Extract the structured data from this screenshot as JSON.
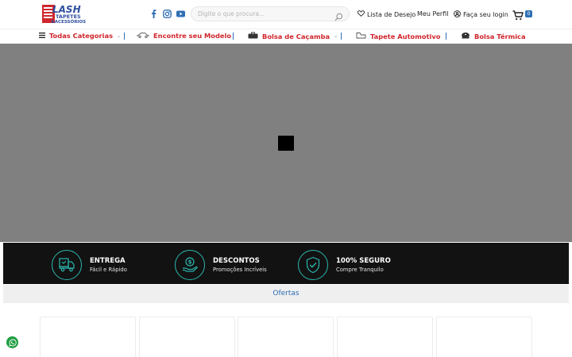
{
  "brand": {
    "logo_text_1": "FLASH",
    "logo_text_2": "TAPETES",
    "logo_text_3": "& ACESSÓRIOS",
    "primary_color": "#d0262c",
    "accent_color": "#2f6fb5"
  },
  "header": {
    "social": [
      "facebook-icon",
      "instagram-icon",
      "youtube-icon"
    ],
    "search_placeholder": "Digite o que procura...",
    "wishlist_label": "Lista de Desejo",
    "profile_label": "Meu Perfil",
    "login_label": "Faça seu login",
    "cart_count": "0"
  },
  "nav": {
    "items": [
      {
        "label": "Todas Categorias",
        "icon": "menu-icon"
      },
      {
        "label": "Encontre seu Modelo",
        "icon": "car-icon"
      },
      {
        "label": "Bolsa de Caçamba",
        "icon": "bag-icon"
      },
      {
        "label": "Tapete Automotivo",
        "icon": "mat-icon"
      },
      {
        "label": "Bolsa Térmica",
        "icon": "cooler-icon"
      }
    ]
  },
  "benefits": [
    {
      "title": "ENTREGA",
      "subtitle": "Fácil e Rápido",
      "icon": "delivery-truck-icon"
    },
    {
      "title": "DESCONTOS",
      "subtitle": "Promoções Incríveis",
      "icon": "discount-hand-icon"
    },
    {
      "title": "100% SEGURO",
      "subtitle": "Compre Tranquilo",
      "icon": "shield-check-icon"
    }
  ],
  "offers": {
    "heading": "Ofertas"
  }
}
